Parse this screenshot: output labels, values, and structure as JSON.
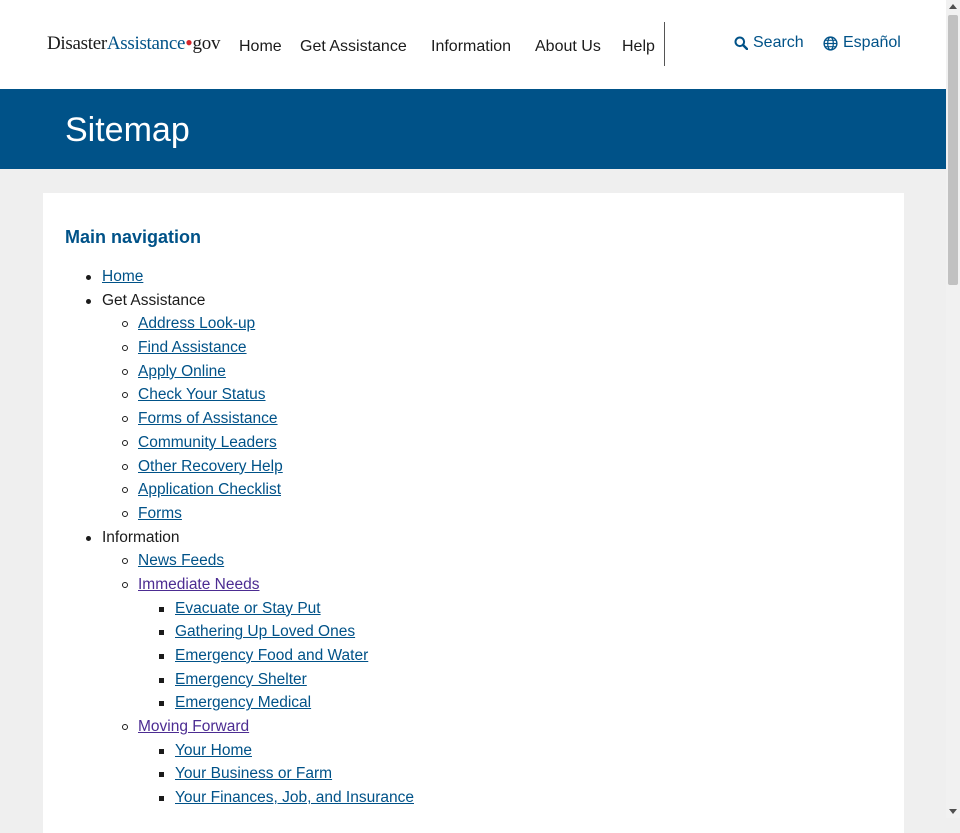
{
  "header": {
    "logo_part1": "Disaster",
    "logo_part2": "Assistance",
    "logo_dot": "•",
    "logo_part3": "gov",
    "nav": [
      "Home",
      "Get Assistance",
      "Information",
      "About Us",
      "Help"
    ],
    "search_label": "Search",
    "language_label": "Español"
  },
  "banner": {
    "title": "Sitemap"
  },
  "sitemap": {
    "heading": "Main navigation",
    "items": [
      {
        "label": "Home",
        "level": 1,
        "link": true
      },
      {
        "label": "Get Assistance",
        "level": 1,
        "link": false
      },
      {
        "label": "Address Look-up",
        "level": 2,
        "link": true
      },
      {
        "label": "Find Assistance",
        "level": 2,
        "link": true
      },
      {
        "label": "Apply Online",
        "level": 2,
        "link": true
      },
      {
        "label": "Check Your Status",
        "level": 2,
        "link": true
      },
      {
        "label": "Forms of Assistance",
        "level": 2,
        "link": true
      },
      {
        "label": "Community Leaders",
        "level": 2,
        "link": true
      },
      {
        "label": "Other Recovery Help",
        "level": 2,
        "link": true
      },
      {
        "label": "Application Checklist",
        "level": 2,
        "link": true
      },
      {
        "label": "Forms",
        "level": 2,
        "link": true
      },
      {
        "label": "Information",
        "level": 1,
        "link": false
      },
      {
        "label": "News Feeds",
        "level": 2,
        "link": true
      },
      {
        "label": "Immediate Needs",
        "level": 2,
        "link": true,
        "visited": true
      },
      {
        "label": "Evacuate or Stay Put",
        "level": 3,
        "link": true
      },
      {
        "label": "Gathering Up Loved Ones",
        "level": 3,
        "link": true
      },
      {
        "label": "Emergency Food and Water",
        "level": 3,
        "link": true
      },
      {
        "label": "Emergency Shelter",
        "level": 3,
        "link": true
      },
      {
        "label": "Emergency Medical",
        "level": 3,
        "link": true
      },
      {
        "label": "Moving Forward",
        "level": 2,
        "link": true,
        "visited": true
      },
      {
        "label": "Your Home",
        "level": 3,
        "link": true
      },
      {
        "label": "Your Business or Farm",
        "level": 3,
        "link": true
      },
      {
        "label": "Your Finances, Job, and Insurance",
        "level": 3,
        "link": true
      }
    ]
  },
  "colors": {
    "brand": "#005288",
    "visited": "#4c2c92",
    "logo_dot": "#d6262c"
  }
}
